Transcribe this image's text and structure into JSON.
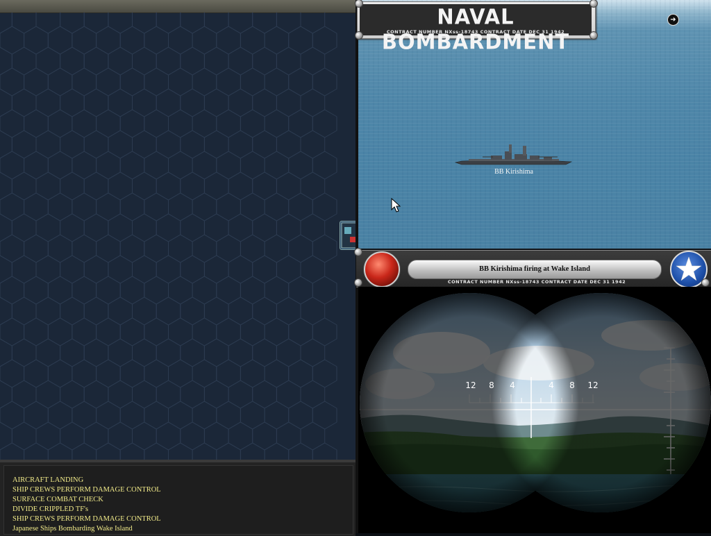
{
  "header": {
    "title": "NAVAL BOMBARDMENT",
    "contract_line": "CONTRACT NUMBER   NXss-18743          CONTRACT DATE  DEC  31  1942"
  },
  "sea_view": {
    "ship_label": "BB Kirishima"
  },
  "status_bar": {
    "message": "BB Kirishima firing at Wake Island",
    "contract_line": "CONTRACT NUMBER   NXss-18743          CONTRACT DATE  DEC  31  1942"
  },
  "binoculars": {
    "scale_left": [
      "12",
      "8",
      "4"
    ],
    "scale_right": [
      "4",
      "8",
      "12"
    ]
  },
  "log": {
    "lines": [
      "AIRCRAFT LANDING",
      "SHIP CREWS PERFORM DAMAGE CONTROL",
      "SURFACE COMBAT CHECK",
      "DIVIDE CRIPPLED TF's",
      "SHIP CREWS PERFORM DAMAGE CONTROL",
      "Japanese Ships Bombarding Wake Island"
    ]
  },
  "icons": {
    "next": "arrow-right-icon",
    "nationality": "us-star-icon",
    "action": "red-button-icon"
  },
  "colors": {
    "map_bg": "#1b2738",
    "log_text": "#f2eb8a",
    "sea": "#4a83a6"
  }
}
